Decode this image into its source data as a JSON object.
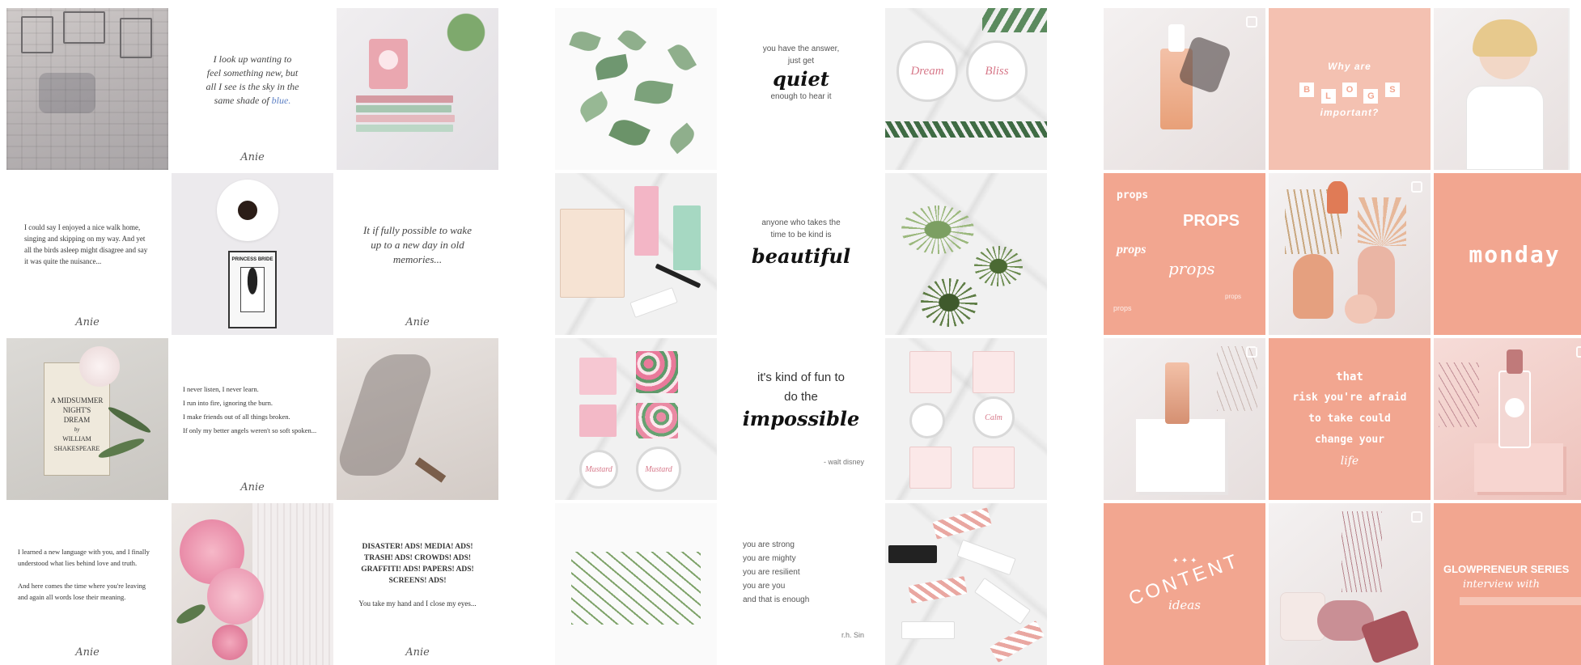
{
  "grid1": {
    "signature": "Anie",
    "quote_blue": {
      "before": "I look up wanting to feel something new, but all I see is the sky in the same shade of",
      "accent": "blue."
    },
    "quote_walk": "I could say I enjoyed a nice walk home, singing and skipping on my way. And yet all the birds asleep might disagree and say it was quite the nuisance...",
    "quote_new_day": "It if fully possible to wake up to a new day in old memories...",
    "quote_never_listen": [
      "I never listen, I never learn.",
      "I run into fire, ignoring the burn.",
      "I make friends out of all things broken.",
      "If only my better angels weren't so soft spoken..."
    ],
    "quote_language": {
      "p1": "I learned a new language with you, and I finally understood what lies behind love and truth.",
      "p2": "And here comes the time where you're leaving and again all words lose their meaning."
    },
    "quote_disaster": {
      "caps": "DISASTER! ADS! MEDIA! ADS! TRASH! ADS! CROWDS! ADS! GRAFFITI! ADS! PAPERS! ADS! SCREENS! ADS!",
      "line": "You take my hand and I close my eyes..."
    },
    "book_title": "PRINCESS BRIDE",
    "midsummer": {
      "line1": "A MIDSUMMER",
      "line2": "NIGHT'S",
      "line3": "DREAM",
      "by": "by",
      "author1": "WILLIAM",
      "author2": "SHAKESPEARE"
    }
  },
  "grid2": {
    "quote_quiet": {
      "l1": "you have the answer,",
      "l2": "just get",
      "big": "quiet",
      "l3": "enough to hear it"
    },
    "quote_beautiful": {
      "l1": "anyone who takes the",
      "l2": "time to be kind is",
      "big": "beautiful"
    },
    "quote_impossible": {
      "l1": "it's kind of fun to",
      "l2": "do the",
      "big": "impossible",
      "credit": "- walt disney"
    },
    "quote_strong": {
      "lines": [
        "you are strong",
        "you are mighty",
        "you are resilient",
        "you are you",
        "and that is enough"
      ],
      "credit": "r.h. Sin"
    },
    "jar_labels": {
      "a": "Dream",
      "b": "Bliss"
    },
    "jar_labels2": {
      "a": "Mustard",
      "b": "Mustard"
    },
    "tin_label": "Calm"
  },
  "grid3": {
    "blogs": {
      "l1": "Why are",
      "letters": [
        "B",
        "L",
        "O",
        "G",
        "S"
      ],
      "l3": "important?"
    },
    "props": {
      "a": "props",
      "b": "PROPS",
      "c": "props",
      "d": "props",
      "e": "props",
      "f": "props"
    },
    "monday": "monday",
    "risk": {
      "l1": "that",
      "l2": "risk you're afraid",
      "l3": "to take could",
      "l4": "change your",
      "l5": "life"
    },
    "content": {
      "a": "CONTENT",
      "b": "ideas"
    },
    "glowpreneur": {
      "a": "GLOWPRENEUR SERIES",
      "b": "interview with"
    }
  }
}
